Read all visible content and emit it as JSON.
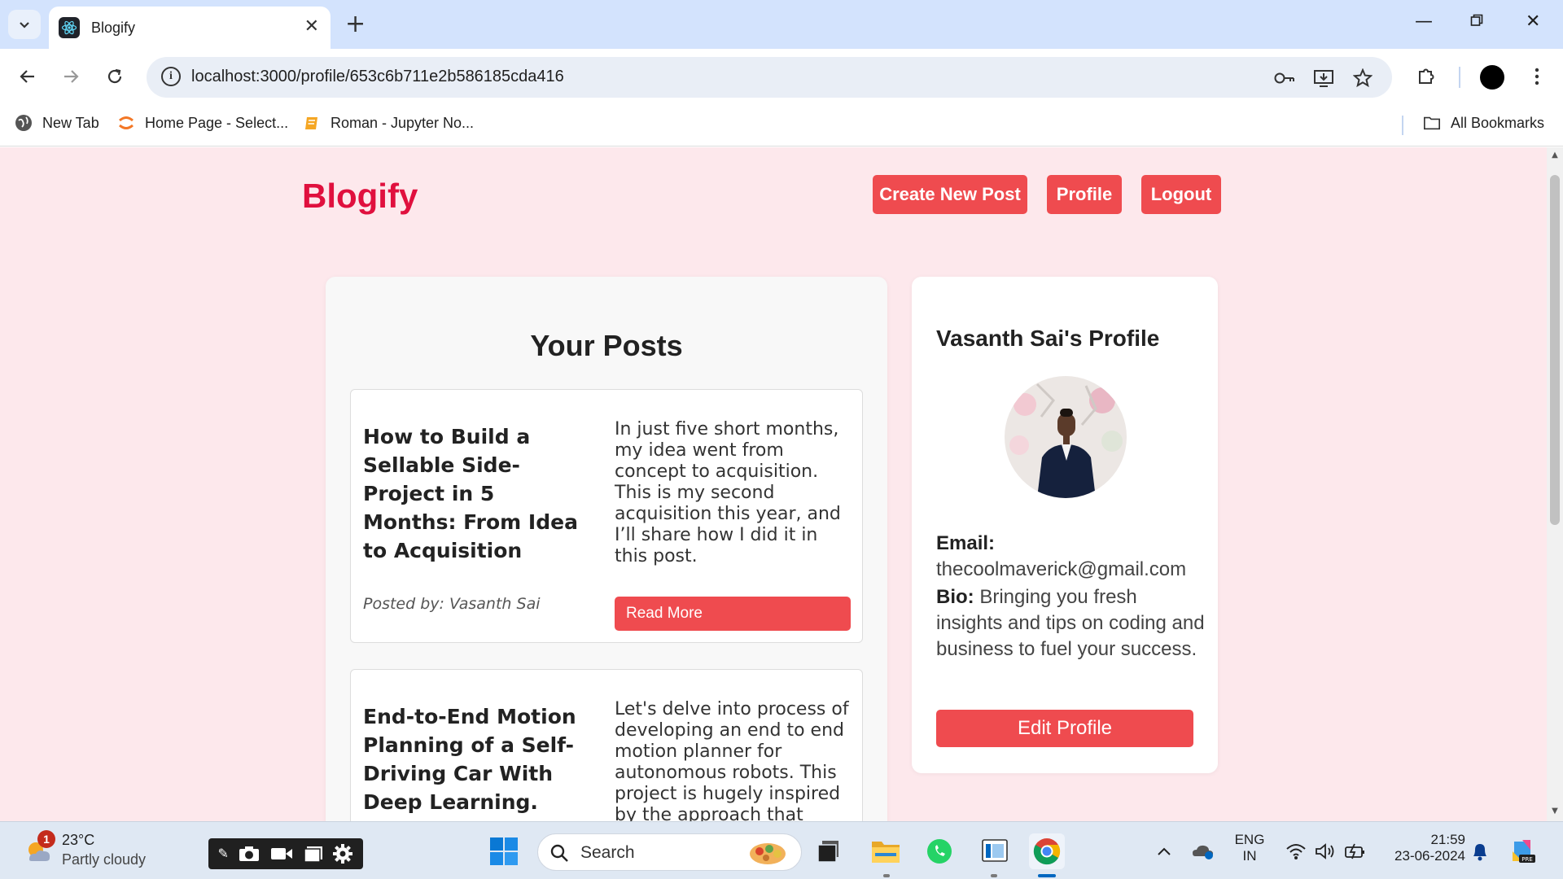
{
  "browser": {
    "tab_title": "Blogify",
    "url": "localhost:3000/profile/653c6b711e2b586185cda416",
    "bookmarks": [
      "New Tab",
      "Home Page - Select...",
      "Roman - Jupyter No..."
    ],
    "all_bookmarks_label": "All Bookmarks"
  },
  "header": {
    "brand": "Blogify",
    "create_label": "Create New Post",
    "profile_label": "Profile",
    "logout_label": "Logout"
  },
  "posts_section": {
    "title": "Your Posts",
    "posts": [
      {
        "title": "How to Build a Sellable Side-Project in 5 Months: From Idea to Acquisition",
        "description": "In just five short months, my idea went from concept to acquisition. This is my second acquisition this year, and I’ll share how I did it in this post.",
        "author": "Posted by: Vasanth Sai",
        "button": "Read More"
      },
      {
        "title": "End-to-End Motion Planning of a Self-Driving Car With Deep Learning.",
        "description": "Let's delve into process of developing an end to end motion planner for autonomous robots. This project is hugely inspired by the approach that",
        "author": "",
        "button": ""
      }
    ]
  },
  "profile": {
    "name": "Vasanth Sai's Profile",
    "email_label": "Email:",
    "email": "thecoolmaverick@gmail.com",
    "bio_label": "Bio:",
    "bio": "Bringing you fresh insights and tips on coding and business to fuel your success.",
    "edit_label": "Edit Profile"
  },
  "taskbar": {
    "weather_badge": "1",
    "temperature": "23°C",
    "condition": "Partly cloudy",
    "search_label": "Search",
    "lang_top": "ENG",
    "lang_bottom": "IN",
    "time": "21:59",
    "date": "23-06-2024"
  },
  "colors": {
    "accent": "#ef4b4f",
    "brand": "#e0103e",
    "page_background": "#fde8ec"
  }
}
